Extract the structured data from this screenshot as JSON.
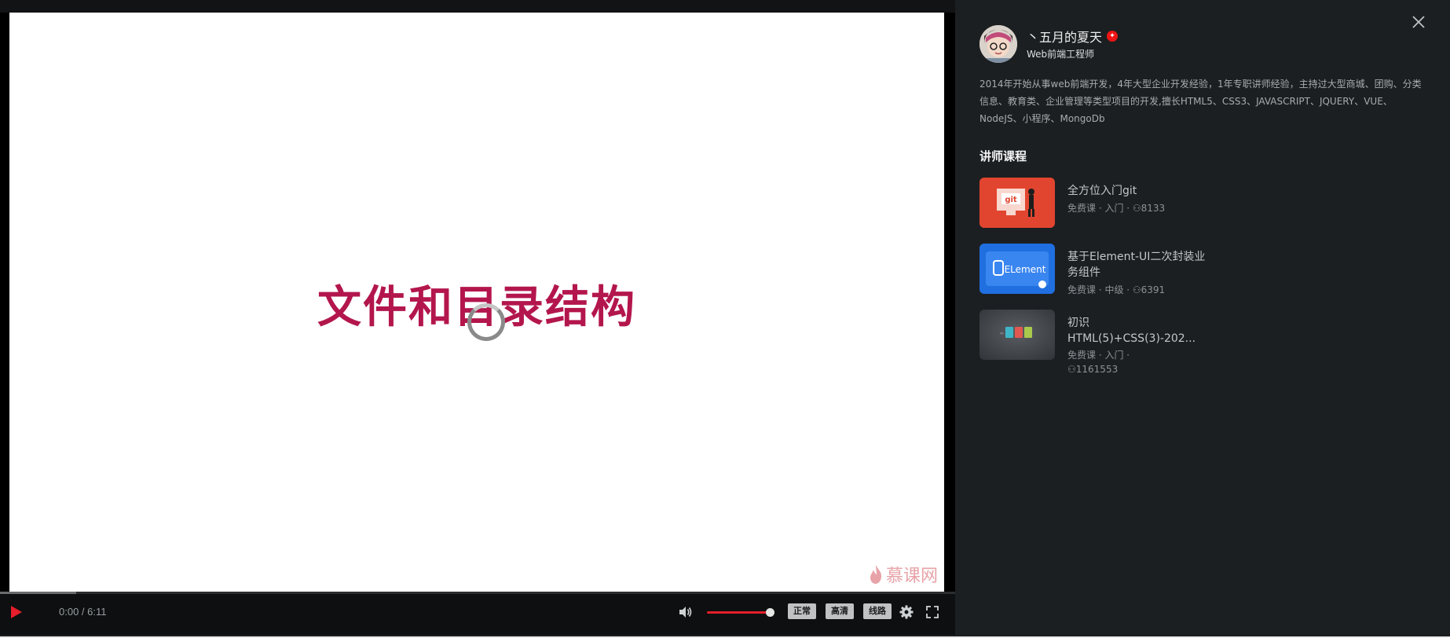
{
  "player": {
    "slide_title": "文件和目录结构",
    "watermark": "慕课网",
    "time": "0:00 / 6:11",
    "played_fraction": 0,
    "buffered_fraction": 0.08,
    "volume_fraction": 0.9,
    "buttons": {
      "rate": "正常",
      "quality": "高清",
      "line": "线路"
    },
    "accent_color": "#e41e2a"
  },
  "teacher": {
    "name": "丶五月的夏天",
    "role": "Web前端工程师",
    "bio": "2014年开始从事web前端开发，4年大型企业开发经验，1年专职讲师经验，主持过大型商城、团购、分类信息、教育类、企业管理等类型项目的开发,擅长HTML5、CSS3、JAVASCRIPT、JQUERY、VUE、NodeJS、小程序、MongoDb"
  },
  "courses_section": {
    "title": "讲师课程",
    "items": [
      {
        "title": "全方位入门git",
        "meta": "免费课 · 入门 · ",
        "learners": "8133",
        "thumb_label": "git"
      },
      {
        "title": "基于Element-UI二次封装业务组件",
        "meta": "免费课 · 中级 · ",
        "learners": "6391",
        "thumb_label": "ELement"
      },
      {
        "title": "初识HTML(5)+CSS(3)-202...",
        "meta": "免费课 · 入门 · ",
        "learners": "1161553",
        "thumb_label": ""
      }
    ]
  }
}
